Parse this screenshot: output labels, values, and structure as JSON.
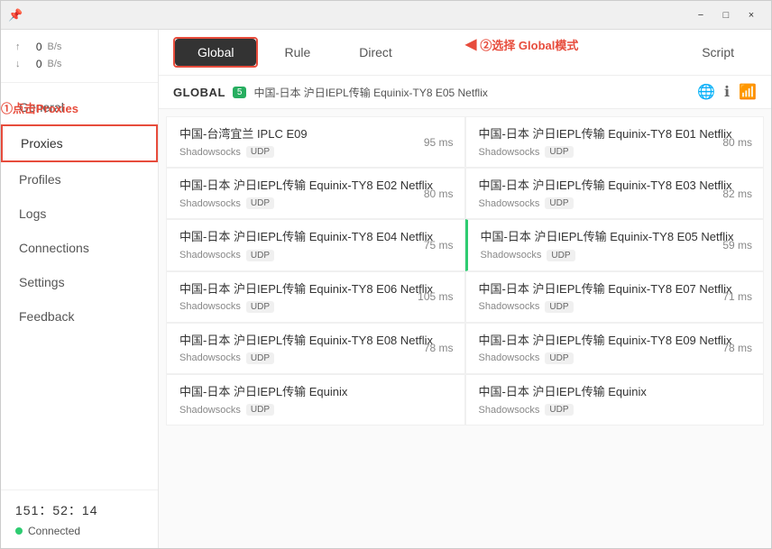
{
  "titlebar": {
    "pin_label": "📌",
    "minimize_label": "−",
    "maximize_label": "□",
    "close_label": "×"
  },
  "sidebar": {
    "speed_up_arrow": "↑",
    "speed_down_arrow": "↓",
    "speed_up_val": "0",
    "speed_up_unit": "B/s",
    "speed_down_val": "0",
    "speed_down_unit": "B/s",
    "nav_items": [
      {
        "id": "general",
        "label": "General",
        "active": false
      },
      {
        "id": "proxies",
        "label": "Proxies",
        "active": true
      },
      {
        "id": "profiles",
        "label": "Profiles",
        "active": false
      },
      {
        "id": "logs",
        "label": "Logs",
        "active": false
      },
      {
        "id": "connections",
        "label": "Connections",
        "active": false
      },
      {
        "id": "settings",
        "label": "Settings",
        "active": false
      },
      {
        "id": "feedback",
        "label": "Feedback",
        "active": false
      }
    ],
    "time": "151：52：14",
    "status": "Connected",
    "annotation1": "①点击Proxies"
  },
  "mode_tabs": [
    {
      "id": "global",
      "label": "Global",
      "active": true
    },
    {
      "id": "rule",
      "label": "Rule",
      "active": false
    },
    {
      "id": "direct",
      "label": "Direct",
      "active": false
    },
    {
      "id": "script",
      "label": "Script",
      "active": false
    }
  ],
  "annotation2": "②选择 Global模式",
  "proxy_header": {
    "name": "GLOBAL",
    "badge": "5",
    "detail": "中国-日本 沪日IEPL传输 Equinix-TY8 E05 Netflix"
  },
  "proxy_cards": [
    {
      "name": "中国-台湾宜兰 IPLC E09",
      "type": "Shadowsocks",
      "badge": "UDP",
      "latency": "95 ms",
      "selected": false
    },
    {
      "name": "中国-日本 沪日IEPL传输 Equinix-TY8 E01 Netflix",
      "type": "Shadowsocks",
      "badge": "UDP",
      "latency": "80 ms",
      "selected": false
    },
    {
      "name": "中国-日本 沪日IEPL传输 Equinix-TY8 E02 Netflix",
      "type": "Shadowsocks",
      "badge": "UDP",
      "latency": "80 ms",
      "selected": false
    },
    {
      "name": "中国-日本 沪日IEPL传输 Equinix-TY8 E03 Netflix",
      "type": "Shadowsocks",
      "badge": "UDP",
      "latency": "82 ms",
      "selected": false
    },
    {
      "name": "中国-日本 沪日IEPL传输 Equinix-TY8 E04 Netflix",
      "type": "Shadowsocks",
      "badge": "UDP",
      "latency": "75 ms",
      "selected": false
    },
    {
      "name": "中国-日本 沪日IEPL传输 Equinix-TY8 E05 Netflix",
      "type": "Shadowsocks",
      "badge": "UDP",
      "latency": "59 ms",
      "selected": true
    },
    {
      "name": "中国-日本 沪日IEPL传输 Equinix-TY8 E06 Netflix",
      "type": "Shadowsocks",
      "badge": "UDP",
      "latency": "105 ms",
      "selected": false
    },
    {
      "name": "中国-日本 沪日IEPL传输 Equinix-TY8 E07 Netflix",
      "type": "Shadowsocks",
      "badge": "UDP",
      "latency": "71 ms",
      "selected": false
    },
    {
      "name": "中国-日本 沪日IEPL传输 Equinix-TY8 E08 Netflix",
      "type": "Shadowsocks",
      "badge": "UDP",
      "latency": "78 ms",
      "selected": false
    },
    {
      "name": "中国-日本 沪日IEPL传输 Equinix-TY8 E09 Netflix",
      "type": "Shadowsocks",
      "badge": "UDP",
      "latency": "78 ms",
      "selected": false
    },
    {
      "name": "中国-日本 沪日IEPL传输 Equinix",
      "type": "Shadowsocks",
      "badge": "UDP",
      "latency": "",
      "selected": false
    },
    {
      "name": "中国-日本 沪日IEPL传输 Equinix",
      "type": "Shadowsocks",
      "badge": "UDP",
      "latency": "",
      "selected": false
    }
  ]
}
